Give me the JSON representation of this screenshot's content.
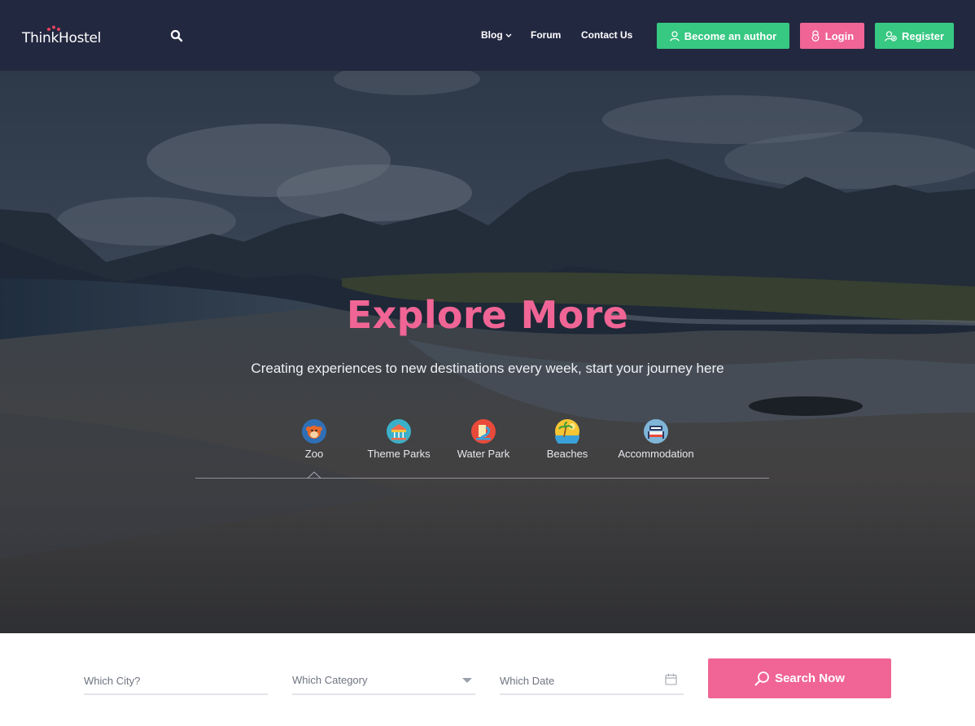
{
  "brand": {
    "logo_text": "ThinkHostel",
    "accent": "#f06595",
    "green": "#37c882",
    "nav_bg": "#232841"
  },
  "nav": {
    "search_icon": "search-icon",
    "links": [
      {
        "label": "Blog",
        "has_dropdown": true
      },
      {
        "label": "Forum"
      },
      {
        "label": "Contact Us"
      }
    ],
    "buttons": {
      "author": {
        "label": "Become an author",
        "icon": "user-icon"
      },
      "login": {
        "label": "Login",
        "icon": "lock-icon"
      },
      "register": {
        "label": "Register",
        "icon": "user-plus-icon"
      }
    }
  },
  "hero": {
    "title": "Explore More",
    "subtitle": "Creating experiences to new destinations every week, start your journey here",
    "categories": [
      {
        "label": "Zoo",
        "icon": "monkey-icon",
        "active": true
      },
      {
        "label": "Theme Parks",
        "icon": "carousel-icon"
      },
      {
        "label": "Water Park",
        "icon": "water-slide-icon"
      },
      {
        "label": "Beaches",
        "icon": "palm-beach-icon"
      },
      {
        "label": "Accommodation",
        "icon": "hotel-bed-icon"
      }
    ]
  },
  "search": {
    "city_placeholder": "Which City?",
    "category_placeholder": "Which Category",
    "date_placeholder": "Which Date",
    "button_label": "Search Now"
  }
}
